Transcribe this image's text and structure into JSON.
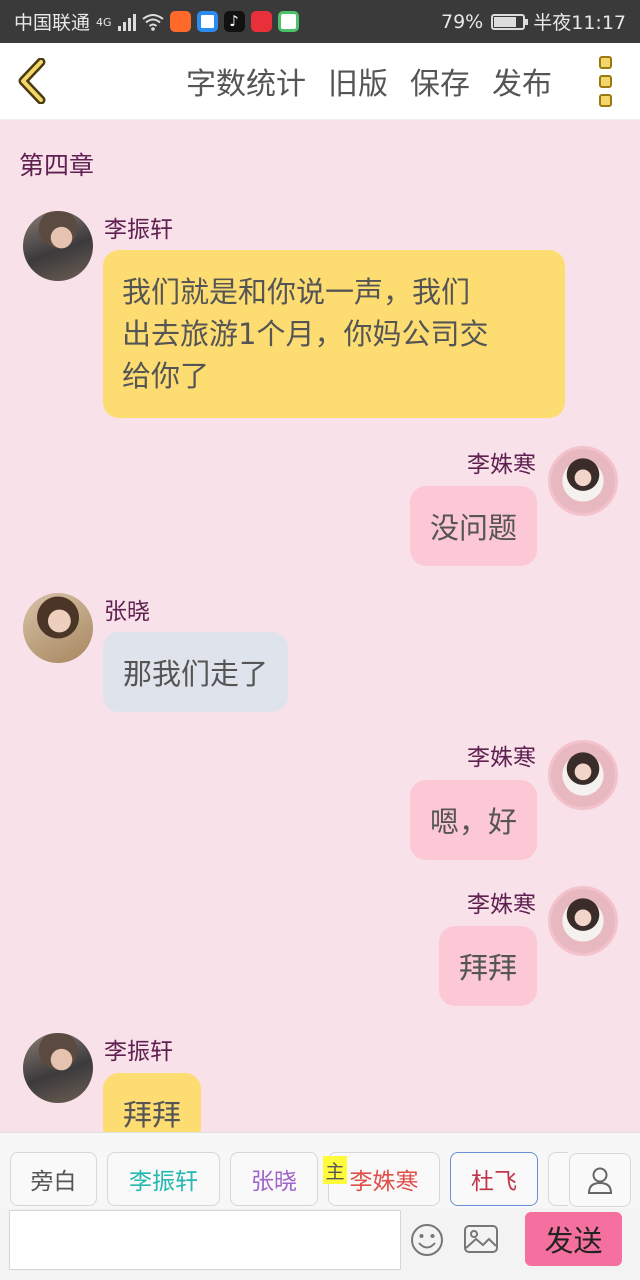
{
  "status_bar": {
    "carrier": "中国联通",
    "network": "4G",
    "battery_percent": "79%",
    "battery_level": 0.79,
    "time": "半夜11:17",
    "app_icons": [
      "kuaishou-icon",
      "qq-browser-icon",
      "tiktok-icon",
      "xiaohongshu-icon",
      "video-app-icon"
    ]
  },
  "toolbar": {
    "word_count": "字数统计",
    "old_version": "旧版",
    "save": "保存",
    "publish": "发布"
  },
  "chat": {
    "chapter": "第四章",
    "messages": [
      {
        "speaker": "李振轩",
        "text_lines": [
          "我们就是和你说一声，我们",
          "出去旅游1个月，你妈公司交",
          "给你了"
        ],
        "side": "left",
        "bubble_color": "#fddd72"
      },
      {
        "speaker": "李姝寒",
        "text": "没问题",
        "side": "right",
        "bubble_color": "#fdc8d6"
      },
      {
        "speaker": "张晓",
        "text": "那我们走了",
        "side": "left",
        "bubble_color": "#dfe3eb"
      },
      {
        "speaker": "李姝寒",
        "text": "嗯，好",
        "side": "right",
        "bubble_color": "#fdc8d6"
      },
      {
        "speaker": "李姝寒",
        "text": "拜拜",
        "side": "right",
        "bubble_color": "#fdc8d6"
      },
      {
        "speaker": "李振轩",
        "text": "拜拜",
        "side": "left",
        "bubble_color": "#fddd72"
      }
    ]
  },
  "roles": {
    "items": [
      {
        "label": "旁白",
        "color": "#555555"
      },
      {
        "label": "李振轩",
        "color": "#26b7b0"
      },
      {
        "label": "张晓",
        "color": "#a064c8"
      },
      {
        "label": "李姝寒",
        "color": "#e0504a"
      },
      {
        "label": "杜飞",
        "color": "#c0344a"
      }
    ],
    "host_tag": "主",
    "selected": "杜飞"
  },
  "input": {
    "placeholder": "",
    "value": "",
    "send_label": "发送"
  }
}
